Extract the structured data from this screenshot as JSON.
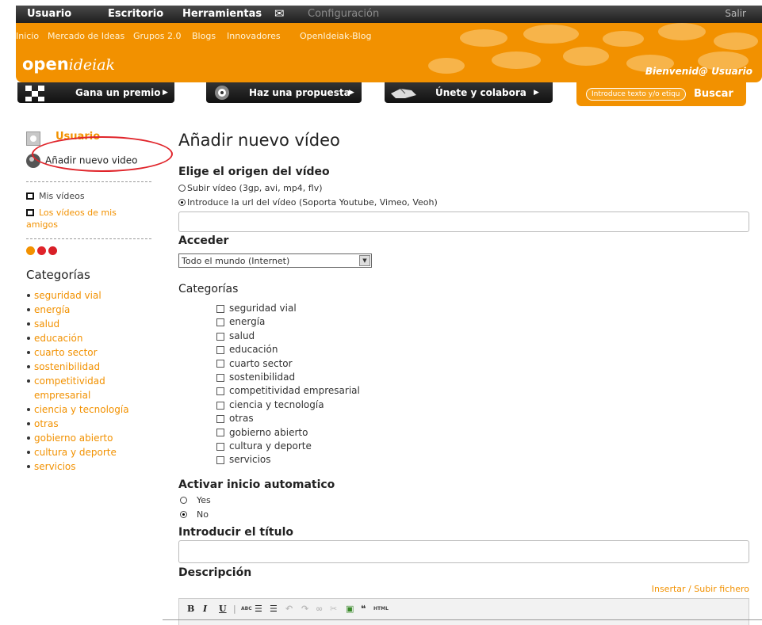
{
  "topbar": {
    "items": [
      "Usuario",
      "Escritorio",
      "Herramientas",
      "Configuración"
    ],
    "mail_icon": "envelope-icon",
    "logout": "Salir"
  },
  "subnav": [
    "Inicio",
    "Mercado de Ideas",
    "Grupos 2.0",
    "Blogs",
    "Innovadores",
    "OpenIdeiak-Blog"
  ],
  "brand": {
    "open": "open",
    "ideiak": "ideiak",
    "color": "#f29100"
  },
  "welcome": {
    "prefix": "Bienvenid@",
    "user": "Usuario"
  },
  "promos": [
    "Gana un premio",
    "Haz una propuesta",
    "Únete y colabora"
  ],
  "search": {
    "placeholder": "Introduce texto y/o etiqueta",
    "button": "Buscar"
  },
  "sidebar": {
    "user": "Usuario",
    "add_video": "Añadir nuevo video",
    "my_videos": "Mis vídeos",
    "friends_videos": "Los vídeos de mis amigos",
    "categories_title": "Categorías",
    "categories": [
      "seguridad vial",
      "energía",
      "salud",
      "educación",
      "cuarto sector",
      "sostenibilidad",
      "competitividad empresarial",
      "ciencia y tecnología",
      "otras",
      "gobierno abierto",
      "cultura y deporte",
      "servicios"
    ]
  },
  "main": {
    "title": "Añadir nuevo vídeo",
    "origin": {
      "heading": "Elige el origen del vídeo",
      "upload": "Subir vídeo (3gp, avi, mp4, flv)",
      "url": "Introduce la url del vídeo (Soporta Youtube, Vimeo, Veoh)",
      "selected": "url"
    },
    "access": {
      "heading": "Acceder",
      "selected": "Todo el mundo (Internet)"
    },
    "categories_heading": "Categorías",
    "categories": [
      "seguridad vial",
      "energía",
      "salud",
      "educación",
      "cuarto sector",
      "sostenibilidad",
      "competitividad empresarial",
      "ciencia y tecnología",
      "otras",
      "gobierno abierto",
      "cultura y deporte",
      "servicios"
    ],
    "autoplay": {
      "heading": "Activar inicio automatico",
      "yes": "Yes",
      "no": "No",
      "selected": "No"
    },
    "title_field": {
      "heading": "Introducir el título",
      "value": ""
    },
    "description": {
      "heading": "Descripción",
      "upload_link": "Insertar / Subir fichero"
    },
    "editor_toolbar": [
      "B",
      "I",
      "U",
      "ABC",
      "HTML"
    ]
  }
}
